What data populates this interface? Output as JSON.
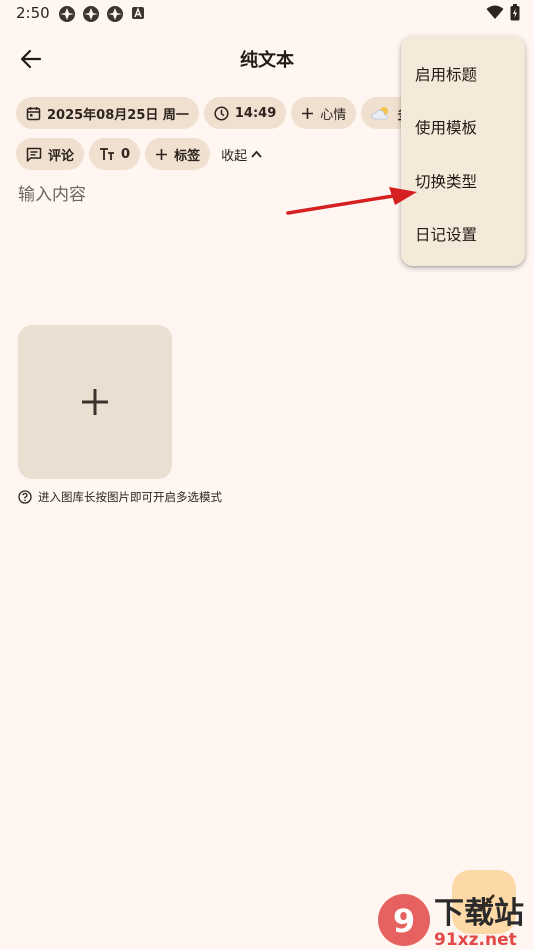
{
  "status_bar": {
    "time": "2:50"
  },
  "app_bar": {
    "title": "纯文本"
  },
  "chips_row1": {
    "date": "2025年08月25日 周一",
    "time": "14:49",
    "mood": "心情",
    "weather": "多"
  },
  "chips_row2": {
    "comment": "评论",
    "word_count": "0",
    "tag": "标签",
    "collapse": "收起"
  },
  "editor": {
    "placeholder": "输入内容"
  },
  "hint": {
    "text": "进入图库长按图片即可开启多选模式"
  },
  "menu": {
    "items": [
      {
        "label": "启用标题"
      },
      {
        "label": "使用模板"
      },
      {
        "label": "切换类型"
      },
      {
        "label": "日记设置"
      }
    ]
  },
  "watermark": {
    "line1": "下载站",
    "line2": "91xz.net"
  },
  "colors": {
    "background": "#FFF6F1",
    "chip": "#EFE0D0",
    "menu": "#F5E9DA",
    "fab": "#FDD9A8",
    "annotation_arrow": "#D42020"
  },
  "icons": [
    "back-arrow-icon",
    "calendar-icon",
    "clock-icon",
    "plus-icon",
    "weather-cloud-icon",
    "comment-icon",
    "text-size-icon",
    "chevron-up-icon",
    "help-circle-icon",
    "check-icon",
    "wifi-icon",
    "battery-icon"
  ]
}
